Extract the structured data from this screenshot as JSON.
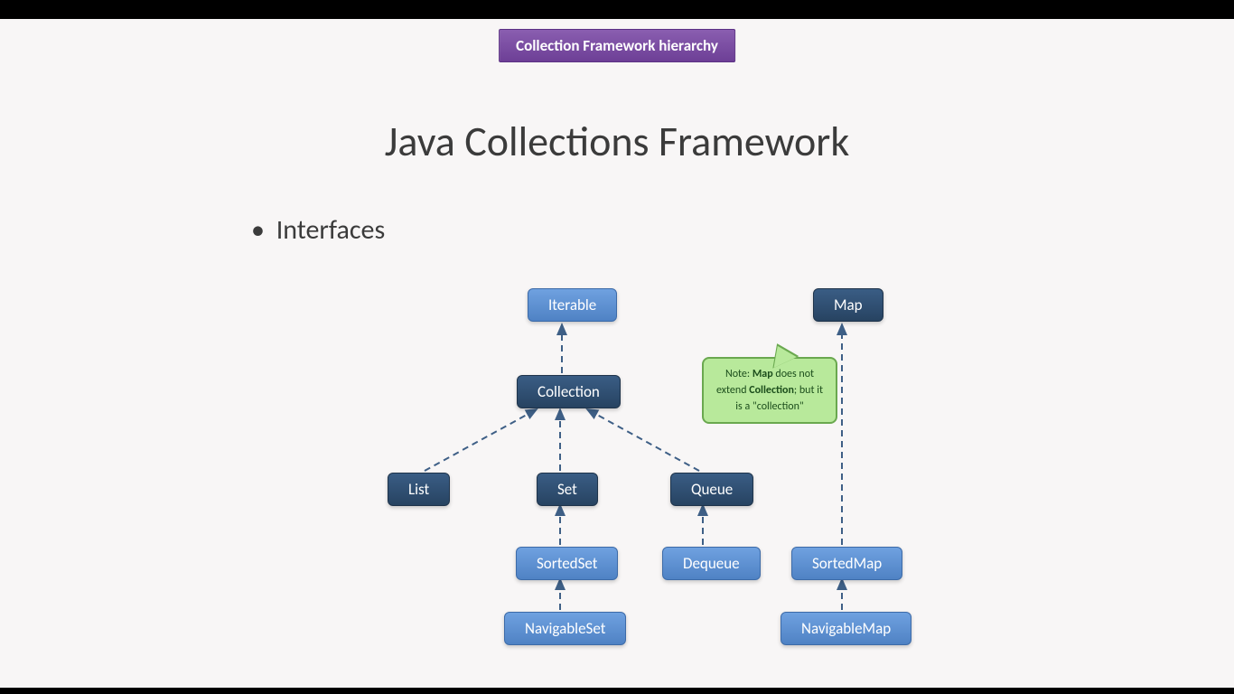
{
  "header": {
    "banner": "Collection Framework hierarchy"
  },
  "title": "Java Collections Framework",
  "bullet": "Interfaces",
  "nodes": {
    "iterable": "Iterable",
    "collection": "Collection",
    "list": "List",
    "set": "Set",
    "queue": "Queue",
    "sortedset": "SortedSet",
    "navigableset": "NavigableSet",
    "dequeue": "Dequeue",
    "map": "Map",
    "sortedmap": "SortedMap",
    "navigablemap": "NavigableMap"
  },
  "callout": {
    "line1": "Note: ",
    "bold1": "Map",
    "line2": " does not extend ",
    "bold2": "Collection",
    "line3": "; but it is a \"collection\""
  },
  "colors": {
    "dark_node": "#274361",
    "light_node": "#4f82c4",
    "callout_bg": "#b8e99b",
    "callout_border": "#6aa84f",
    "arrow": "#3e5f86"
  }
}
